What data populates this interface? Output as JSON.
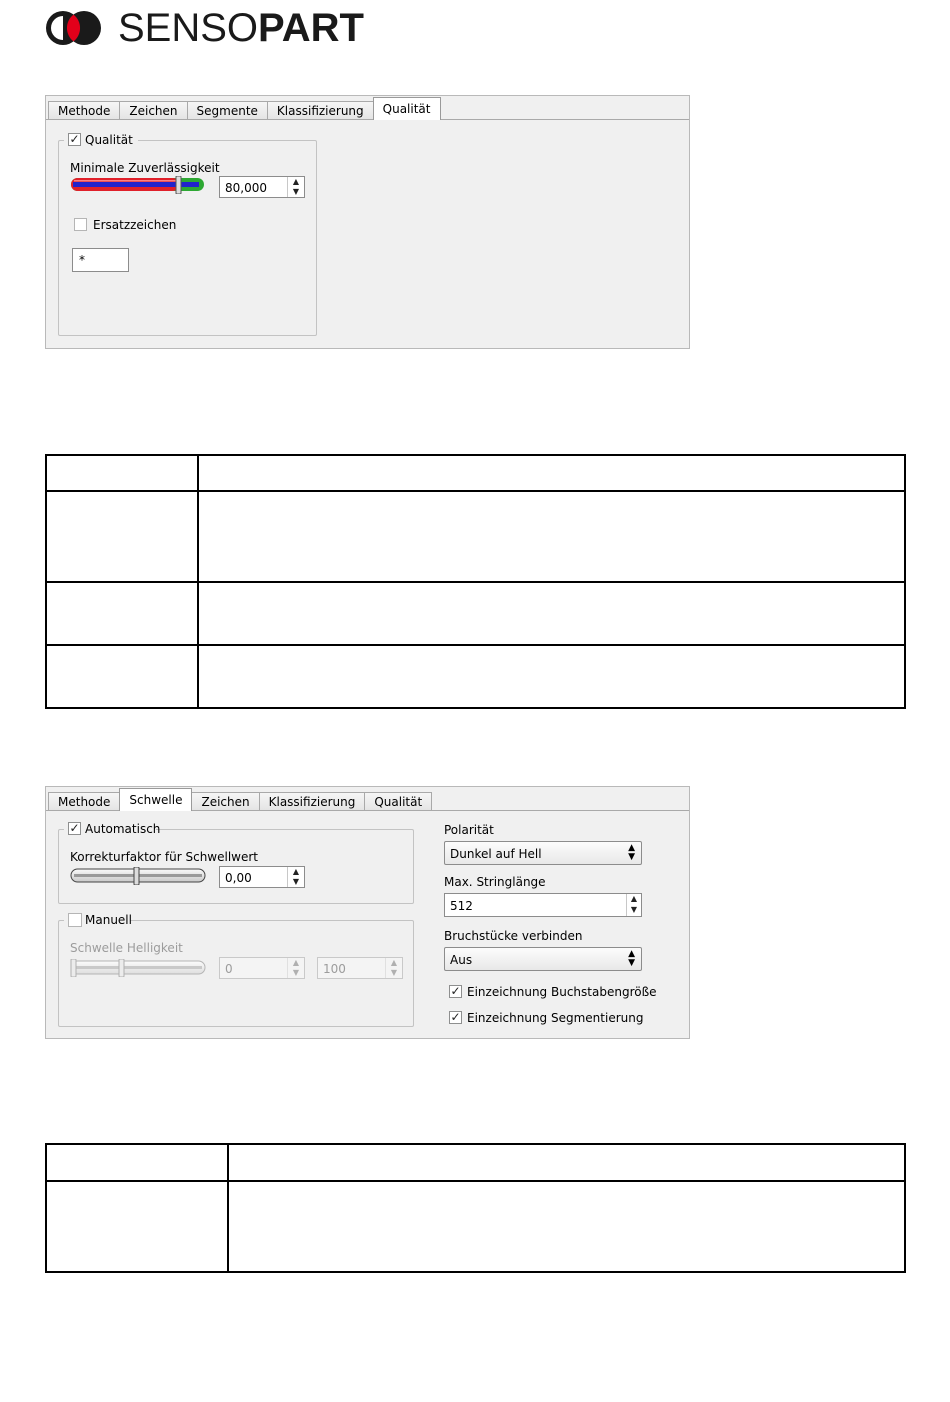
{
  "brand": {
    "name_light": "SENSO",
    "name_bold": "PART"
  },
  "panel1": {
    "tabs": [
      "Methode",
      "Zeichen",
      "Segmente",
      "Klassifizierung",
      "Qualität"
    ],
    "active_tab": "Qualität",
    "group_quality": {
      "label": "Qualität",
      "checked": true
    },
    "min_confidence": {
      "label": "Minimale Zuverlässigkeit",
      "value": "80,000",
      "slider_fraction": 0.8
    },
    "substitute": {
      "label": "Ersatzzeichen",
      "checked": false,
      "value": "*"
    }
  },
  "panel2": {
    "tabs": [
      "Methode",
      "Schwelle",
      "Zeichen",
      "Klassifizierung",
      "Qualität"
    ],
    "active_tab": "Schwelle",
    "automatic": {
      "label": "Automatisch",
      "checked": true,
      "correction_label": "Korrekturfaktor für Schwellwert",
      "correction_value": "0,00",
      "slider_fraction": 0.5
    },
    "manual": {
      "label": "Manuell",
      "checked": false,
      "threshold_label": "Schwelle Helligkeit",
      "min_value": "0",
      "max_value": "100"
    },
    "polarity": {
      "label": "Polarität",
      "value": "Dunkel auf Hell"
    },
    "max_string_length": {
      "label": "Max. Stringlänge",
      "value": "512"
    },
    "connect_fragments": {
      "label": "Bruchstücke verbinden",
      "value": "Aus"
    },
    "draw_char_size": {
      "label": "Einzeichnung Buchstabengröße",
      "checked": true
    },
    "draw_segmentation": {
      "label": "Einzeichnung Segmentierung",
      "checked": true
    }
  },
  "colors": {
    "slider_red": "#e0202a",
    "slider_blue": "#2222cc",
    "slider_green": "#2da833",
    "logo_red": "#e2001a"
  }
}
